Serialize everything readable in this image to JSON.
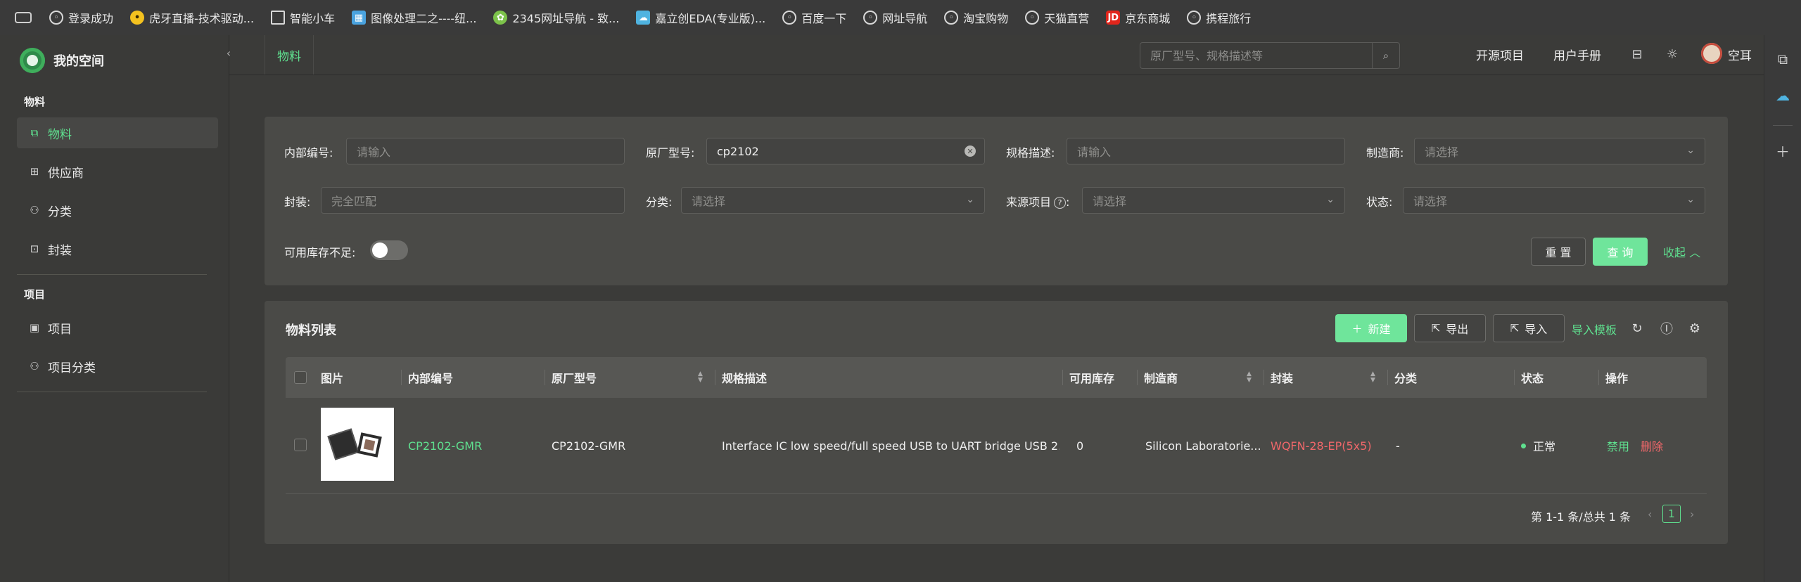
{
  "bookmarks": [
    {
      "label": "登录成功",
      "icon": "globe-icon"
    },
    {
      "label": "虎牙直播-技术驱动...",
      "icon": "tiger-icon"
    },
    {
      "label": "智能小车",
      "icon": "folder-icon"
    },
    {
      "label": "图像处理二之----纽...",
      "icon": "grid-icon"
    },
    {
      "label": "2345网址导航 - 致...",
      "icon": "leaf-icon"
    },
    {
      "label": "嘉立创EDA(专业版)...",
      "icon": "cloud-icon"
    },
    {
      "label": "百度一下",
      "icon": "globe-icon"
    },
    {
      "label": "网址导航",
      "icon": "globe-icon"
    },
    {
      "label": "淘宝购物",
      "icon": "globe-icon"
    },
    {
      "label": "天猫直营",
      "icon": "globe-icon"
    },
    {
      "label": "京东商城",
      "icon": "jd-icon",
      "badge": "JD"
    },
    {
      "label": "携程旅行",
      "icon": "globe-icon"
    }
  ],
  "sidebar": {
    "brand": "我的空间",
    "section1": "物料",
    "items1": [
      {
        "label": "物料",
        "icon": "copy-icon"
      },
      {
        "label": "供应商",
        "icon": "supplier-icon"
      },
      {
        "label": "分类",
        "icon": "tree-icon"
      },
      {
        "label": "封装",
        "icon": "package-icon"
      }
    ],
    "section2": "项目",
    "items2": [
      {
        "label": "项目",
        "icon": "project-icon"
      },
      {
        "label": "项目分类",
        "icon": "tree-icon"
      }
    ]
  },
  "topbar": {
    "tab": "物料",
    "search_placeholder": "原厂型号、规格描述等",
    "link1": "开源项目",
    "link2": "用户手册",
    "username": "空耳"
  },
  "filters": {
    "internal_no_label": "内部编号:",
    "internal_no_placeholder": "请输入",
    "mfr_part_label": "原厂型号:",
    "mfr_part_value": "cp2102",
    "spec_label": "规格描述:",
    "spec_placeholder": "请输入",
    "manufacturer_label": "制造商:",
    "manufacturer_placeholder": "请选择",
    "package_label": "封装:",
    "package_placeholder": "完全匹配",
    "category_label": "分类:",
    "category_placeholder": "请选择",
    "source_label": "来源项目",
    "source_placeholder": "请选择",
    "status_label": "状态:",
    "status_placeholder": "请选择",
    "low_stock_label": "可用库存不足:",
    "reset": "重 置",
    "query": "查 询",
    "collapse": "收起"
  },
  "list": {
    "title": "物料列表",
    "new": "新建",
    "export": "导出",
    "import": "导入",
    "import_template": "导入模板",
    "columns": [
      "图片",
      "内部编号",
      "原厂型号",
      "规格描述",
      "可用库存",
      "制造商",
      "封装",
      "分类",
      "状态",
      "操作"
    ],
    "rows": [
      {
        "internal_no": "CP2102-GMR",
        "mfr_part": "CP2102-GMR",
        "spec": "Interface IC low speed/full speed USB to UART bridge USB 2....",
        "stock": "0",
        "manufacturer": "Silicon Laboratorie...",
        "package": "WQFN-28-EP(5x5)",
        "category": "-",
        "status": "正常",
        "action_disable": "禁用",
        "action_delete": "删除"
      }
    ],
    "pager_text": "第 1-1 条/总共 1 条",
    "current_page": "1"
  },
  "colors": {
    "accent": "#5fe08f",
    "danger": "#f0676a",
    "background": "#3b3b39",
    "panel": "#4a4a47"
  }
}
